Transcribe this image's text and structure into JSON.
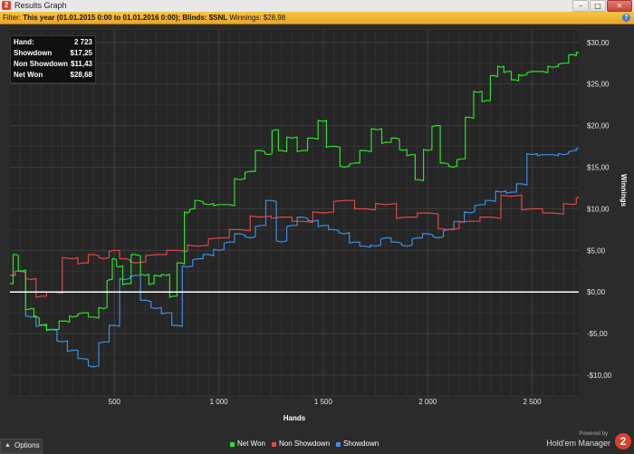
{
  "window": {
    "title": "Results Graph",
    "app_icon": "2",
    "buttons": [
      "minimize-icon",
      "maximize-icon",
      "close-icon"
    ]
  },
  "filter": {
    "prefix": "Filter:",
    "period": "This year (01.01.2015 0:00 to 01.01.2016 0:00);",
    "blinds": "Blinds: $SNL",
    "winnings": "Winnings: $28,98",
    "help_icon": "?"
  },
  "stats": [
    {
      "label": "Hand:",
      "value": "2 723"
    },
    {
      "label": "Showdown",
      "value": "$17,25"
    },
    {
      "label": "Non Showdown",
      "value": "$11,43"
    },
    {
      "label": "Net Won",
      "value": "$28,68"
    }
  ],
  "options": {
    "label": "Options",
    "arrow": "▲"
  },
  "branding": {
    "powered_by": "Powered by",
    "name": "Hold'em Manager",
    "logo": "2"
  },
  "colors": {
    "net_won": "#2ee02e",
    "non_showdown": "#e04848",
    "showdown": "#3f8fe0",
    "zero_line": "#ffffff"
  },
  "chart_data": {
    "type": "line",
    "xlabel": "Hands",
    "ylabel": "Winnings",
    "xlim": [
      0,
      2723
    ],
    "ylim": [
      -12.5,
      31.5
    ],
    "x_ticks": [
      500,
      1000,
      1500,
      2000,
      2500
    ],
    "x_tick_labels": [
      "500",
      "1 000",
      "1 500",
      "2 000",
      "2 500"
    ],
    "y_ticks": [
      30,
      25,
      20,
      15,
      10,
      5,
      0,
      -5,
      -10
    ],
    "y_tick_labels": [
      "$30,00",
      "$25,00",
      "$20,00",
      "$15,00",
      "$10,00",
      "$5,00",
      "$0,00",
      "-$5,00",
      "-$10,00"
    ],
    "grid": true,
    "legend_position": "bottom",
    "series": [
      {
        "name": "Net Won",
        "x": [
          0,
          30,
          50,
          100,
          130,
          150,
          200,
          270,
          300,
          350,
          400,
          450,
          480,
          500,
          520,
          560,
          600,
          650,
          680,
          700,
          750,
          780,
          820,
          850,
          870,
          900,
          950,
          1000,
          1050,
          1100,
          1150,
          1200,
          1240,
          1270,
          1300,
          1350,
          1400,
          1450,
          1500,
          1530,
          1560,
          1600,
          1650,
          1700,
          1760,
          1800,
          1850,
          1880,
          1920,
          1960,
          2000,
          2040,
          2080,
          2120,
          2160,
          2200,
          2240,
          2280,
          2320,
          2350,
          2380,
          2420,
          2450,
          2500,
          2550,
          2600,
          2650,
          2700,
          2723
        ],
        "values": [
          1,
          4.5,
          2.5,
          -2,
          -3,
          -4,
          -4.5,
          -3.5,
          -3,
          -2.5,
          -3,
          -2,
          1.5,
          4,
          3,
          1,
          4.5,
          2,
          1,
          2,
          2,
          -0.5,
          3.5,
          9.5,
          10,
          11,
          10.5,
          10.5,
          10.5,
          13.5,
          14.5,
          17,
          16.5,
          19.5,
          17,
          18.5,
          17,
          18.5,
          20.5,
          17.5,
          17.5,
          15,
          15.5,
          17,
          19.5,
          18,
          18.5,
          17,
          16.5,
          13.5,
          17,
          20,
          15.5,
          15,
          16,
          21,
          24,
          23,
          26,
          27,
          26.5,
          25.5,
          26,
          26.5,
          26.5,
          27,
          27.5,
          28.5,
          28.7
        ]
      },
      {
        "name": "Non Showdown",
        "x": [
          0,
          50,
          100,
          150,
          200,
          300,
          350,
          400,
          450,
          500,
          550,
          600,
          700,
          800,
          900,
          1000,
          1100,
          1200,
          1300,
          1400,
          1500,
          1600,
          1700,
          1800,
          1900,
          2000,
          2100,
          2200,
          2300,
          2400,
          2500,
          2600,
          2700,
          2723
        ],
        "values": [
          2,
          2.5,
          1.5,
          -0.5,
          0,
          4,
          3.5,
          4.5,
          4,
          5,
          4,
          3.5,
          4.5,
          5,
          5.5,
          6.5,
          7.5,
          9,
          9,
          8.5,
          9.5,
          11,
          10,
          10.5,
          9,
          9.5,
          7.5,
          8.5,
          9,
          11.5,
          10,
          9.5,
          10.5,
          11.4
        ]
      },
      {
        "name": "Showdown",
        "x": [
          0,
          50,
          100,
          150,
          200,
          250,
          300,
          350,
          400,
          450,
          500,
          550,
          600,
          650,
          700,
          750,
          800,
          850,
          900,
          950,
          1000,
          1050,
          1100,
          1150,
          1200,
          1250,
          1300,
          1350,
          1400,
          1450,
          1500,
          1550,
          1600,
          1650,
          1700,
          1750,
          1800,
          1850,
          1900,
          1950,
          2000,
          2050,
          2100,
          2150,
          2200,
          2250,
          2300,
          2350,
          2400,
          2450,
          2500,
          2550,
          2600,
          2650,
          2700,
          2723
        ],
        "values": [
          2,
          2.5,
          -3,
          -4,
          -4.5,
          -6,
          -7,
          -8,
          -9,
          -6,
          -4,
          1.5,
          2,
          -1,
          -2,
          -2.5,
          -4,
          3,
          4,
          4.5,
          5,
          6,
          7,
          6.5,
          8,
          11,
          6,
          8,
          9,
          8.5,
          8,
          7.5,
          7,
          6,
          5.5,
          5.5,
          6.5,
          6,
          5.5,
          6.5,
          7,
          6.5,
          7.5,
          8.5,
          9.5,
          10.5,
          11,
          12,
          12,
          13,
          16.5,
          16.5,
          16.5,
          16.5,
          17,
          17.25
        ]
      }
    ]
  }
}
